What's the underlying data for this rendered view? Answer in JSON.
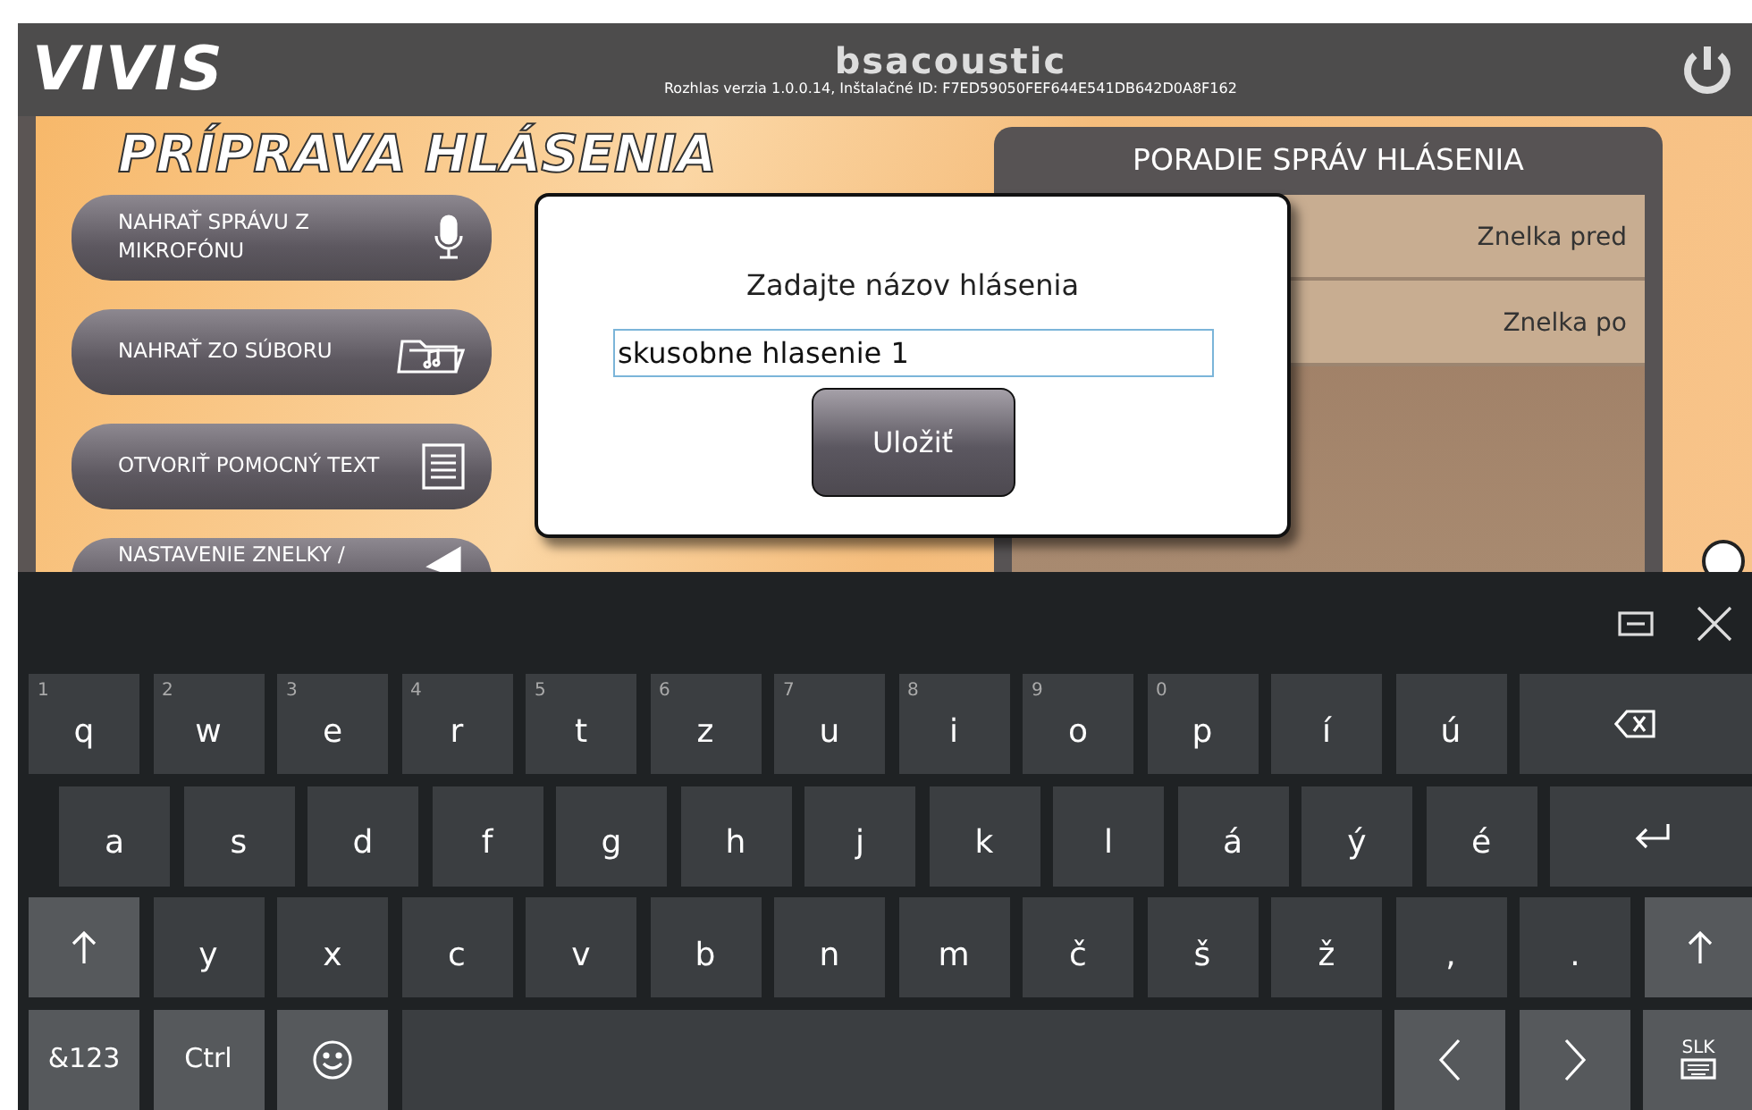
{
  "header": {
    "logo": "VIVIS",
    "brand": "bsacoustic",
    "version": "Rozhlas verzia 1.0.0.14, Inštalačné ID: F7ED59050FEF644E541DB642D0A8F162"
  },
  "panel": {
    "title": "PRÍPRAVA HLÁSENIA",
    "buttons": [
      {
        "label": "NAHRAŤ SPRÁVU Z MIKROFÓNU",
        "kind": "mic"
      },
      {
        "label": "NAHRAŤ ZO SÚBORU",
        "kind": "folder"
      },
      {
        "label": "OTVORIŤ POMOCNÝ TEXT",
        "kind": "text"
      },
      {
        "label": "NASTAVENIE ZNELKY /",
        "kind": "speaker"
      }
    ]
  },
  "order_panel": {
    "title": "PORADIE SPRÁV HLÁSENIA",
    "items": [
      "Znelka pred",
      "Znelka po"
    ]
  },
  "dialog": {
    "prompt": "Zadajte názov hlásenia",
    "value": "skusobne hlasenie 1",
    "button": "Uložiť"
  },
  "keyboard": {
    "rows": [
      [
        {
          "kind": "char",
          "label": "q",
          "hint": "1"
        },
        {
          "kind": "char",
          "label": "w",
          "hint": "2"
        },
        {
          "kind": "char",
          "label": "e",
          "hint": "3"
        },
        {
          "kind": "char",
          "label": "r",
          "hint": "4"
        },
        {
          "kind": "char",
          "label": "t",
          "hint": "5"
        },
        {
          "kind": "char",
          "label": "z",
          "hint": "6"
        },
        {
          "kind": "char",
          "label": "u",
          "hint": "7"
        },
        {
          "kind": "char",
          "label": "i",
          "hint": "8"
        },
        {
          "kind": "char",
          "label": "o",
          "hint": "9"
        },
        {
          "kind": "char",
          "label": "p",
          "hint": "0"
        },
        {
          "kind": "char",
          "label": "í"
        },
        {
          "kind": "char",
          "label": "ú"
        },
        {
          "kind": "backspace"
        }
      ],
      [
        {
          "kind": "char",
          "label": "a"
        },
        {
          "kind": "char",
          "label": "s"
        },
        {
          "kind": "char",
          "label": "d"
        },
        {
          "kind": "char",
          "label": "f"
        },
        {
          "kind": "char",
          "label": "g"
        },
        {
          "kind": "char",
          "label": "h"
        },
        {
          "kind": "char",
          "label": "j"
        },
        {
          "kind": "char",
          "label": "k"
        },
        {
          "kind": "char",
          "label": "l"
        },
        {
          "kind": "char",
          "label": "á"
        },
        {
          "kind": "char",
          "label": "ý"
        },
        {
          "kind": "char",
          "label": "é"
        },
        {
          "kind": "enter"
        }
      ],
      [
        {
          "kind": "shift"
        },
        {
          "kind": "char",
          "label": "y"
        },
        {
          "kind": "char",
          "label": "x"
        },
        {
          "kind": "char",
          "label": "c"
        },
        {
          "kind": "char",
          "label": "v"
        },
        {
          "kind": "char",
          "label": "b"
        },
        {
          "kind": "char",
          "label": "n"
        },
        {
          "kind": "char",
          "label": "m"
        },
        {
          "kind": "char",
          "label": "č"
        },
        {
          "kind": "char",
          "label": "š"
        },
        {
          "kind": "char",
          "label": "ž"
        },
        {
          "kind": "char",
          "label": ","
        },
        {
          "kind": "char",
          "label": "."
        },
        {
          "kind": "shift"
        }
      ],
      [
        {
          "kind": "fn",
          "label": "&123"
        },
        {
          "kind": "fn",
          "label": "Ctrl"
        },
        {
          "kind": "emoji"
        },
        {
          "kind": "space"
        },
        {
          "kind": "left"
        },
        {
          "kind": "right"
        },
        {
          "kind": "layout",
          "label": "SLK"
        }
      ]
    ]
  }
}
